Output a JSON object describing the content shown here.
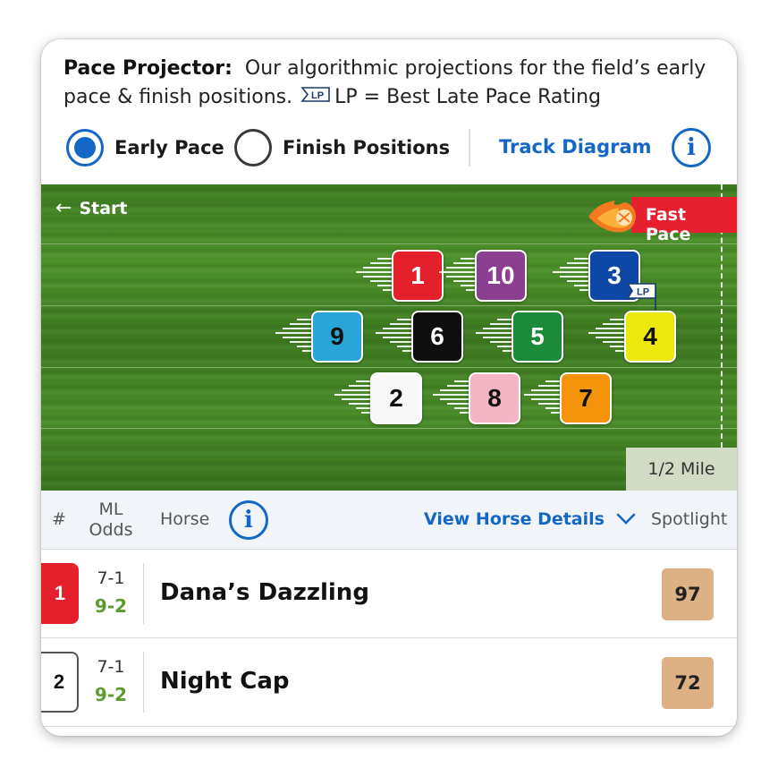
{
  "intro": {
    "title": "Pace Projector:",
    "text": "Our algorithmic projections for the field’s early pace & finish positions.",
    "lp_icon": "LP",
    "lp_text": "LP = Best Late Pace Rating"
  },
  "controls": {
    "early_pace_label": "Early Pace",
    "early_pace_selected": true,
    "finish_positions_label": "Finish Positions",
    "finish_positions_selected": false,
    "track_diagram_label": "Track Diagram",
    "info_icon": "i"
  },
  "track": {
    "start_label": "Start",
    "start_icon": "←",
    "fast_pace_label": "Fast Pace",
    "distance_label": "1/2 Mile",
    "runners": [
      {
        "num": "1",
        "bg": "#e3202b",
        "fg": "#ffffff"
      },
      {
        "num": "10",
        "bg": "#8b3f90",
        "fg": "#ffffff"
      },
      {
        "num": "3",
        "bg": "#0d47a6",
        "fg": "#ffffff",
        "lp": "LP"
      },
      {
        "num": "9",
        "bg": "#2aa5d8",
        "fg": "#111111"
      },
      {
        "num": "6",
        "bg": "#0e0e0e",
        "fg": "#ffffff"
      },
      {
        "num": "5",
        "bg": "#1b8a3a",
        "fg": "#ffffff"
      },
      {
        "num": "4",
        "bg": "#ece80e",
        "fg": "#111111"
      },
      {
        "num": "2",
        "bg": "#f8f8f8",
        "fg": "#111111"
      },
      {
        "num": "8",
        "bg": "#f4b5c4",
        "fg": "#111111"
      },
      {
        "num": "7",
        "bg": "#f5930a",
        "fg": "#111111"
      }
    ]
  },
  "table": {
    "headers": {
      "num": "#",
      "ml": "ML",
      "odds": "Odds",
      "horse": "Horse",
      "view_details": "View Horse Details",
      "spotlight": "Spotlight"
    },
    "rows": [
      {
        "num": "1",
        "bg": "#e3202b",
        "fg": "#ffffff",
        "ml": "7-1",
        "live": "9-2",
        "name": "Dana’s Dazzling",
        "spotlight": "97"
      },
      {
        "num": "2",
        "bg": "#ffffff",
        "fg": "#111111",
        "ml": "7-1",
        "live": "9-2",
        "name": "Night Cap",
        "spotlight": "72"
      }
    ]
  }
}
